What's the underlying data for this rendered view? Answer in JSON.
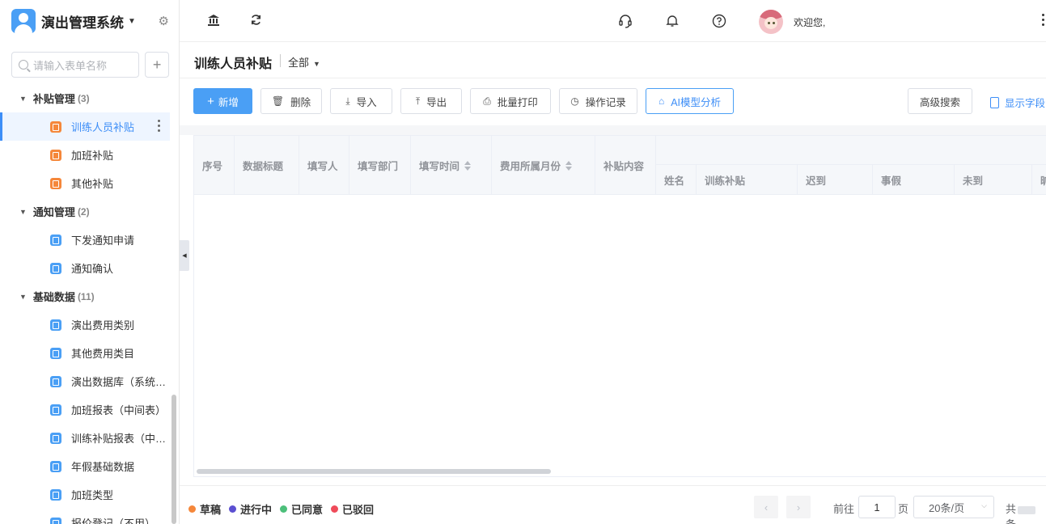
{
  "app": {
    "title": "演出管理系统",
    "search_placeholder": "请输入表单名称"
  },
  "sidebar": {
    "groups": [
      {
        "label": "补贴管理",
        "count": "(3)",
        "items": [
          "训练人员补贴",
          "加班补贴",
          "其他补贴"
        ]
      },
      {
        "label": "通知管理",
        "count": "(2)",
        "items": [
          "下发通知申请",
          "通知确认"
        ]
      },
      {
        "label": "基础数据",
        "count": "(11)",
        "items": [
          "演出费用类别",
          "其他费用类目",
          "演出数据库（系统…",
          "加班报表（中间表）",
          "训练补贴报表（中…",
          "年假基础数据",
          "加班类型",
          "报价登记（不用）"
        ]
      }
    ]
  },
  "topbar": {
    "welcome": "欢迎您,"
  },
  "page": {
    "title": "训练人员补贴",
    "filter": "全部"
  },
  "toolbar": {
    "new": "新增",
    "delete": "删除",
    "import": "导入",
    "export": "导出",
    "batch_print": "批量打印",
    "op_log": "操作记录",
    "ai": "AI模型分析",
    "adv_search": "高级搜索",
    "show_fields": "显示字段"
  },
  "table": {
    "columns": [
      "序号",
      "数据标题",
      "填写人",
      "填写部门",
      "填写时间",
      "费用所属月份",
      "补贴内容"
    ],
    "sub_columns": [
      "姓名",
      "训练补贴",
      "迟到",
      "事假",
      "未到",
      "旷"
    ],
    "rows": []
  },
  "legend": [
    {
      "label": "草稿",
      "color": "#f5873a"
    },
    {
      "label": "进行中",
      "color": "#5b4fd1"
    },
    {
      "label": "已同意",
      "color": "#4cbf7a"
    },
    {
      "label": "已驳回",
      "color": "#ef4b5a"
    }
  ],
  "pagination": {
    "goto": "前往",
    "page": "1",
    "page_unit": "页",
    "page_size": "20条/页",
    "total_prefix": "共",
    "total_suffix": "条"
  }
}
